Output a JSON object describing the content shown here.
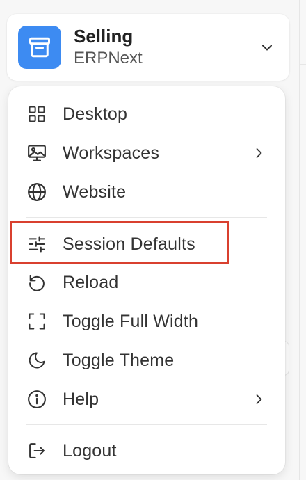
{
  "app": {
    "name": "Selling",
    "subtitle": "ERPNext",
    "logo_color": "#3d8bf2",
    "logo_icon": "archive-box-icon",
    "toggle_icon": "chevron-down-icon"
  },
  "menu": {
    "items": [
      {
        "label": "Desktop",
        "icon": "grid-icon"
      },
      {
        "label": "Workspaces",
        "icon": "image-monitor-icon",
        "submenu": true
      },
      {
        "label": "Website",
        "icon": "globe-icon"
      },
      {
        "label": "Session Defaults",
        "icon": "sliders-icon",
        "highlighted": true
      },
      {
        "label": "Reload",
        "icon": "reload-icon"
      },
      {
        "label": "Toggle Full Width",
        "icon": "expand-corners-icon"
      },
      {
        "label": "Toggle Theme",
        "icon": "moon-icon"
      },
      {
        "label": "Help",
        "icon": "info-icon",
        "submenu": true
      },
      {
        "label": "Logout",
        "icon": "logout-icon"
      }
    ]
  },
  "colors": {
    "highlight_border": "#d9402f",
    "icon_stroke": "#333333"
  }
}
